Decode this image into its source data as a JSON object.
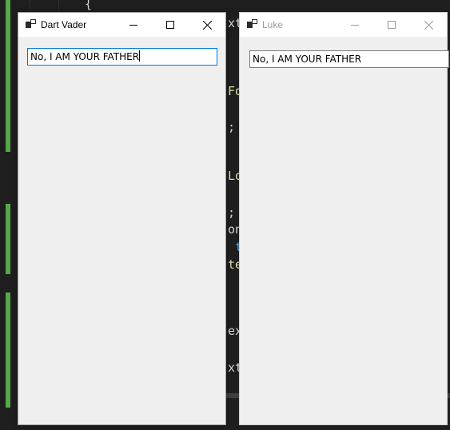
{
  "windows": [
    {
      "title": "Dart Vader",
      "active": true,
      "textbox_value": "No, I AM YOUR FATHER",
      "icon": "app-form-icon",
      "buttons": [
        "minimize-icon",
        "maximize-icon",
        "close-icon"
      ]
    },
    {
      "title": "Luke",
      "active": false,
      "textbox_value": "No, I AM YOUR FATHER",
      "icon": "app-form-icon",
      "buttons": [
        "minimize-icon",
        "maximize-icon",
        "close-icon"
      ]
    }
  ],
  "editor": {
    "fragments": {
      "brace": "{",
      "ext1": "xt",
      "fo": "Fo",
      "semi1": ";",
      "lo": "Lo",
      "semi2": ";",
      "on": "on",
      "kw": "t",
      "te": "te",
      "ex": "ex",
      "xt2": "xt"
    }
  },
  "colors": {
    "editor_background": "#1e1e1e",
    "change_bar": "#57a64a",
    "window_background": "#f0f0f0",
    "focus_border": "#0078d7",
    "inactive_title": "#9a9a9a"
  }
}
